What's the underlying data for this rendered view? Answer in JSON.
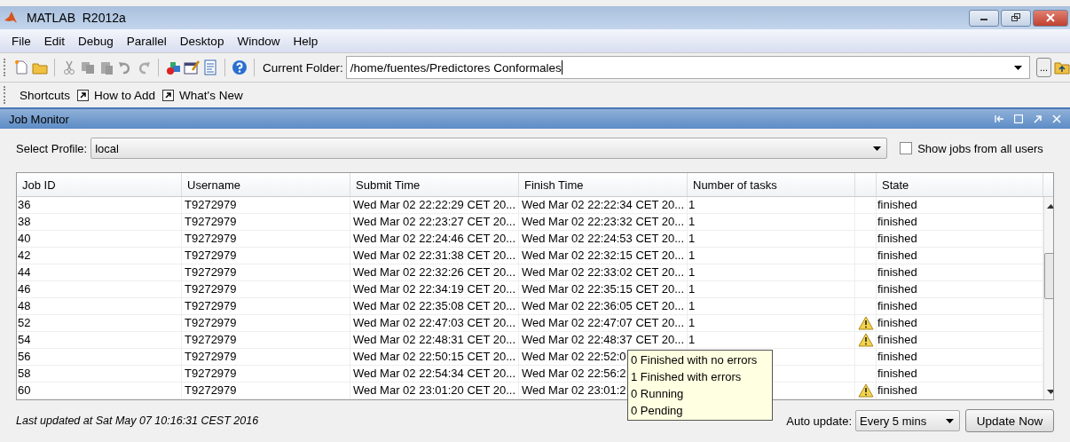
{
  "window": {
    "title": "MATLAB  R2012a"
  },
  "menu": [
    "File",
    "Edit",
    "Debug",
    "Parallel",
    "Desktop",
    "Window",
    "Help"
  ],
  "toolbar": {
    "folder_label": "Current Folder:",
    "folder_value": "/home/fuentes/Predictores Conformales",
    "browse": "..."
  },
  "shortcuts": {
    "label": "Shortcuts",
    "items": [
      "How to Add",
      "What's New"
    ]
  },
  "panel": {
    "title": "Job Monitor"
  },
  "profile": {
    "label": "Select Profile:",
    "value": "local"
  },
  "show_all": {
    "label": "Show jobs from all users",
    "checked": false
  },
  "table": {
    "columns": [
      {
        "label": "Job ID",
        "kind": "text"
      },
      {
        "label": "Username",
        "kind": "text"
      },
      {
        "label": "Submit Time",
        "kind": "text"
      },
      {
        "label": "Finish Time",
        "kind": "text"
      },
      {
        "label": "Number of tasks",
        "kind": "text"
      },
      {
        "kind": "icon"
      },
      {
        "label": "State",
        "kind": "text"
      }
    ],
    "rows": [
      {
        "job_id": "36",
        "username": "T9272979",
        "submit_time": "Wed Mar 02 22:22:29 CET 20...",
        "finish_time": "Wed Mar 02 22:22:34 CET 20...",
        "tasks": "1",
        "warning": false,
        "state": "finished"
      },
      {
        "job_id": "38",
        "username": "T9272979",
        "submit_time": "Wed Mar 02 22:23:27 CET 20...",
        "finish_time": "Wed Mar 02 22:23:32 CET 20...",
        "tasks": "1",
        "warning": false,
        "state": "finished"
      },
      {
        "job_id": "40",
        "username": "T9272979",
        "submit_time": "Wed Mar 02 22:24:46 CET 20...",
        "finish_time": "Wed Mar 02 22:24:53 CET 20...",
        "tasks": "1",
        "warning": false,
        "state": "finished"
      },
      {
        "job_id": "42",
        "username": "T9272979",
        "submit_time": "Wed Mar 02 22:31:38 CET 20...",
        "finish_time": "Wed Mar 02 22:32:15 CET 20...",
        "tasks": "1",
        "warning": false,
        "state": "finished"
      },
      {
        "job_id": "44",
        "username": "T9272979",
        "submit_time": "Wed Mar 02 22:32:26 CET 20...",
        "finish_time": "Wed Mar 02 22:33:02 CET 20...",
        "tasks": "1",
        "warning": false,
        "state": "finished"
      },
      {
        "job_id": "46",
        "username": "T9272979",
        "submit_time": "Wed Mar 02 22:34:19 CET 20...",
        "finish_time": "Wed Mar 02 22:35:15 CET 20...",
        "tasks": "1",
        "warning": false,
        "state": "finished"
      },
      {
        "job_id": "48",
        "username": "T9272979",
        "submit_time": "Wed Mar 02 22:35:08 CET 20...",
        "finish_time": "Wed Mar 02 22:36:05 CET 20...",
        "tasks": "1",
        "warning": false,
        "state": "finished"
      },
      {
        "job_id": "52",
        "username": "T9272979",
        "submit_time": "Wed Mar 02 22:47:03 CET 20...",
        "finish_time": "Wed Mar 02 22:47:07 CET 20...",
        "tasks": "1",
        "warning": true,
        "state": "finished"
      },
      {
        "job_id": "54",
        "username": "T9272979",
        "submit_time": "Wed Mar 02 22:48:31 CET 20...",
        "finish_time": "Wed Mar 02 22:48:37 CET 20...",
        "tasks": "1",
        "warning": true,
        "state": "finished"
      },
      {
        "job_id": "56",
        "username": "T9272979",
        "submit_time": "Wed Mar 02 22:50:15 CET 20...",
        "finish_time": "Wed Mar 02 22:52:0",
        "warning": false,
        "state": "finished"
      },
      {
        "job_id": "58",
        "username": "T9272979",
        "submit_time": "Wed Mar 02 22:54:34 CET 20...",
        "finish_time": "Wed Mar 02 22:56:2",
        "warning": false,
        "state": "finished"
      },
      {
        "job_id": "60",
        "username": "T9272979",
        "submit_time": "Wed Mar 02 23:01:20 CET 20...",
        "finish_time": "Wed Mar 02 23:01:2",
        "warning": true,
        "state": "finished"
      }
    ]
  },
  "tooltip": [
    "0 Finished with no errors",
    "1 Finished with errors",
    "0 Running",
    "0 Pending"
  ],
  "footer": {
    "last_updated": "Last updated at Sat May 07 10:16:31 CEST 2016",
    "auto_update_label": "Auto update:",
    "auto_update_value": "Every 5 mins",
    "button": "Update Now"
  }
}
